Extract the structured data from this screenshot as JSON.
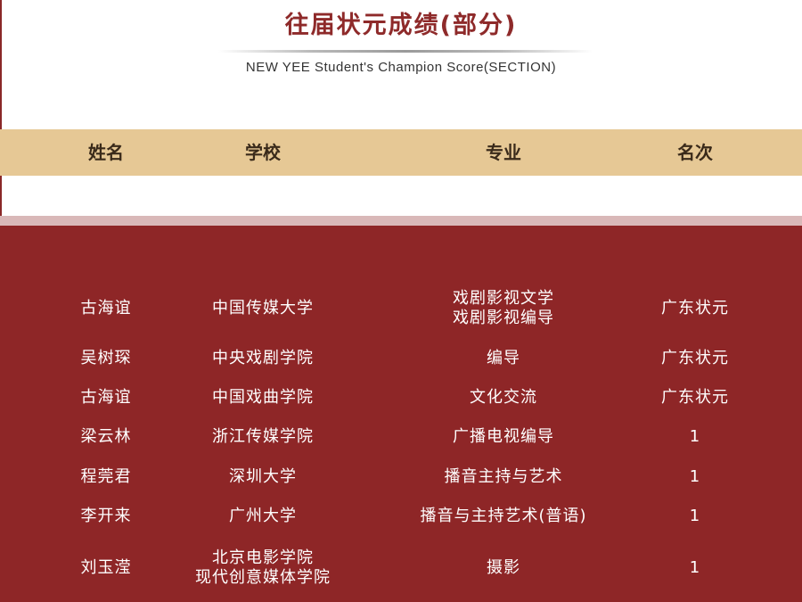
{
  "title": "往届状元成绩(部分)",
  "subtitle": "NEW YEE Student's Champion Score(SECTION)",
  "columns": [
    "姓名",
    "学校",
    "专业",
    "名次"
  ],
  "rows": [
    {
      "name": "古海谊",
      "school": [
        "中国传媒大学"
      ],
      "major": [
        "戏剧影视文学",
        "戏剧影视编导"
      ],
      "rank": "广东状元"
    },
    {
      "name": "吴树琛",
      "school": [
        "中央戏剧学院"
      ],
      "major": [
        "编导"
      ],
      "rank": "广东状元"
    },
    {
      "name": "古海谊",
      "school": [
        "中国戏曲学院"
      ],
      "major": [
        "文化交流"
      ],
      "rank": "广东状元"
    },
    {
      "name": "梁云林",
      "school": [
        "浙江传媒学院"
      ],
      "major": [
        "广播电视编导"
      ],
      "rank": "1"
    },
    {
      "name": "程莞君",
      "school": [
        "深圳大学"
      ],
      "major": [
        "播音主持与艺术"
      ],
      "rank": "1"
    },
    {
      "name": "李开来",
      "school": [
        "广州大学"
      ],
      "major": [
        "播音与主持艺术(普语)"
      ],
      "rank": "1"
    },
    {
      "name": "刘玉滢",
      "school": [
        "北京电影学院",
        "现代创意媒体学院"
      ],
      "major": [
        "摄影"
      ],
      "rank": "1"
    }
  ],
  "colors": {
    "title": "#8e2a2a",
    "header_bg": "#e6c895",
    "panel_bg": "#8e2627",
    "strip": "#d9b8b8"
  }
}
